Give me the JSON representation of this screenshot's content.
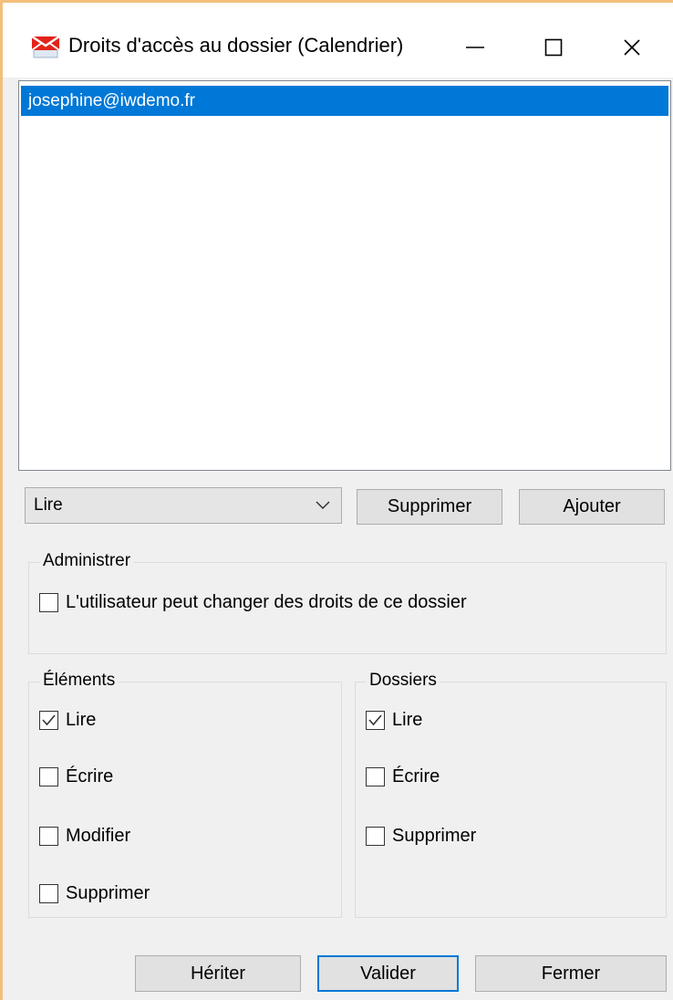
{
  "window": {
    "title": "Droits d'accès au dossier (Calendrier)",
    "minimize_glyph": "—",
    "close_glyph": "✕"
  },
  "users": {
    "items": [
      {
        "label": "josephine@iwdemo.fr",
        "selected": true
      }
    ]
  },
  "permission_select": {
    "value": "Lire"
  },
  "buttons": {
    "supprimer": "Supprimer",
    "ajouter": "Ajouter",
    "heriter": "Hériter",
    "valider": "Valider",
    "fermer": "Fermer"
  },
  "admin_group": {
    "label": "Administrer",
    "checkbox_label": "L'utilisateur peut changer des droits de ce dossier",
    "checked": false
  },
  "elements_group": {
    "label": "Éléments",
    "items": [
      {
        "label": "Lire",
        "checked": true
      },
      {
        "label": "Écrire",
        "checked": false
      },
      {
        "label": "Modifier",
        "checked": false
      },
      {
        "label": "Supprimer",
        "checked": false
      }
    ]
  },
  "dossiers_group": {
    "label": "Dossiers",
    "items": [
      {
        "label": "Lire",
        "checked": true
      },
      {
        "label": "Écrire",
        "checked": false
      },
      {
        "label": "Supprimer",
        "checked": false
      }
    ]
  },
  "colors": {
    "selection": "#0078d7",
    "window_border": "#f3bf7b",
    "face": "#f0f0f0"
  },
  "icons": {
    "app": "mail-envelope-icon",
    "minimize": "minimize-icon",
    "maximize": "maximize-icon",
    "close": "close-icon",
    "dropdown": "chevron-down-icon",
    "checkmark": "checkmark-icon"
  }
}
